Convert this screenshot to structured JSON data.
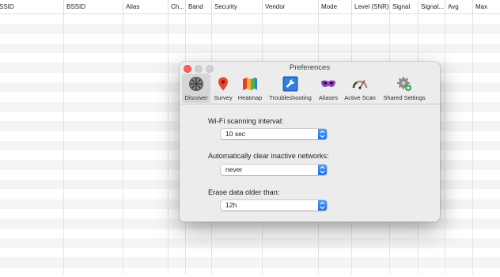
{
  "table": {
    "columns": [
      "SSID",
      "BSSID",
      "Alias",
      "Ch...",
      "Band",
      "Security",
      "Vendor",
      "Mode",
      "Level (SNR)",
      "Signal",
      "Signal...",
      "Avg",
      "Max"
    ]
  },
  "preferences": {
    "title": "Preferences",
    "toolbar": [
      {
        "label": "Discover",
        "icon": "discover-icon"
      },
      {
        "label": "Survey",
        "icon": "survey-pin-icon"
      },
      {
        "label": "Heatmap",
        "icon": "heatmap-icon"
      },
      {
        "label": "Troubleshooting",
        "icon": "wrench-icon"
      },
      {
        "label": "Aliases",
        "icon": "mask-icon"
      },
      {
        "label": "Active Scan",
        "icon": "gauge-icon"
      },
      {
        "label": "Shared Settings",
        "icon": "shared-settings-gear-icon"
      }
    ],
    "active_tab": "Discover",
    "fields": {
      "scan_interval": {
        "label": "Wi-Fi scanning interval:",
        "value": "10 sec"
      },
      "auto_clear": {
        "label": "Automatically clear inactive networks:",
        "value": "never"
      },
      "erase_data": {
        "label": "Erase data older than:",
        "value": "12h"
      }
    }
  },
  "colors": {
    "accent": "#2f7ef5",
    "close": "#fc5f57"
  }
}
